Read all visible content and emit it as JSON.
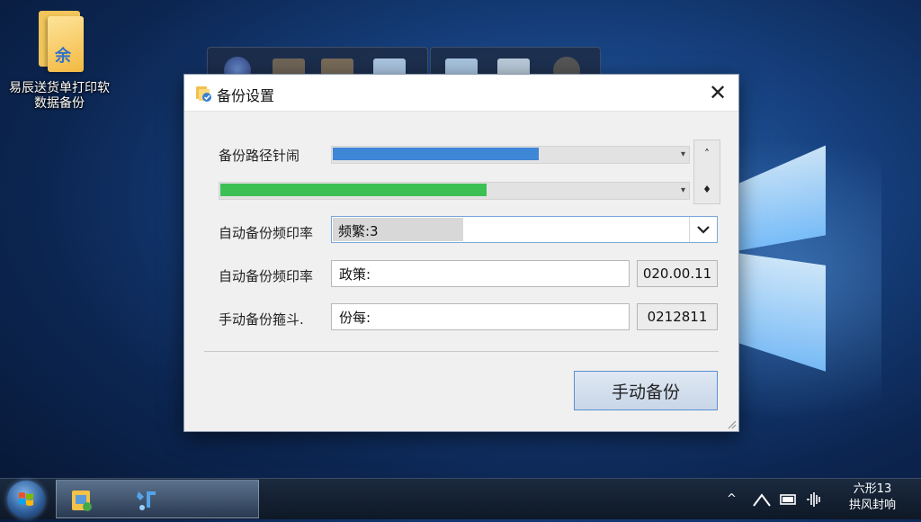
{
  "desktop": {
    "icon_label_line1": "易辰送货单打印软",
    "icon_label_line2": "数据备份",
    "icon_glyph": "余"
  },
  "dialog": {
    "title": "备份设置",
    "close_glyph": "✕",
    "path_label": "备份路径针闹",
    "path_progress_blue": 0.58,
    "path_progress_green": 0.57,
    "spin_up": "˄",
    "spin_down": "♦",
    "auto_freq_label": "自动备份频印率",
    "auto_freq_value": "频繁:3",
    "auto_freq2_label": "自动备份频印率",
    "auto_freq2_value": "政策:",
    "auto_freq2_number": "020.00.11",
    "manual_label": "手动备份箍斗.",
    "manual_value": "份每:",
    "manual_number": "0212811",
    "manual_button": "手动备份"
  },
  "colors": {
    "blue_fill": "#3e86d6",
    "green_fill": "#3cc054",
    "accent_border": "#5b8fcf"
  },
  "taskbar": {
    "tray_chevron": "^",
    "clock_line1": "六形13",
    "clock_line2": "拱风封响"
  }
}
